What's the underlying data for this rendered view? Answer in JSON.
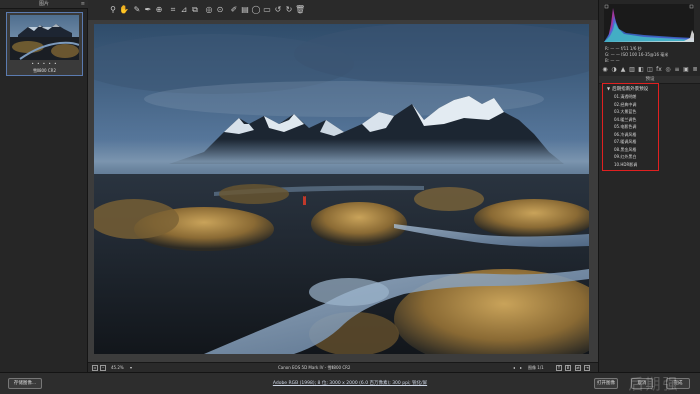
{
  "filmstrip": {
    "title": "图片",
    "thumb_stars": "• • • • •",
    "thumb_name": "雪Ⅱ800 CR2"
  },
  "toolbar": {
    "tools": [
      "zoom-icon",
      "hand-icon",
      "white-balance-icon",
      "color-sampler-icon",
      "target-adjust-icon",
      "crop-icon",
      "straighten-icon",
      "transform-icon",
      "spot-removal-icon",
      "red-eye-icon",
      "adjustment-brush-icon",
      "graduated-filter-icon",
      "radial-filter-icon",
      "preferences-icon",
      "rotate-left-icon",
      "rotate-right-icon",
      "trash-icon"
    ],
    "fullscreen_glyph": "↗"
  },
  "canvas_footer": {
    "zoom": "45.2%",
    "camera_info": "Canon EOS 5D Mark IV  -  雪Ⅱ800 CR2",
    "image_counter": "图像 1/1",
    "view_mode_y": "Y",
    "view_mode_b": "B"
  },
  "histogram": {
    "rgb_line": "R: — —   f/11   1/6 秒",
    "g_line": "G: — —   ISO 100   16-35@16 毫米",
    "b_line": "B: — —"
  },
  "right_panel": {
    "section_label": "预设",
    "preset_title": "预设",
    "preset_group": "后期指南外景预设",
    "presets": [
      "01.清透明朗",
      "02.经典中调",
      "03.大景蓝色",
      "04.暖兰调色",
      "05.电影色调",
      "06.冷调风格",
      "07.暖调风格",
      "08.黑金风格",
      "09.红外黑白",
      "10.HDR影调"
    ]
  },
  "bottom_bar": {
    "save_label": "存储图像...",
    "workflow_text": "Adobe RGB (1998); 8 位; 3000 x 2000 (6.0 百万像素); 300 ppi; 锐化/屏",
    "open_label": "打开图像",
    "cancel_label": "取消",
    "done_label": "完成",
    "watermark": "后期强"
  },
  "colors": {
    "selection_border": "#e02020",
    "thumb_selected": "#5b7bb0",
    "panel_bg": "#262626"
  }
}
